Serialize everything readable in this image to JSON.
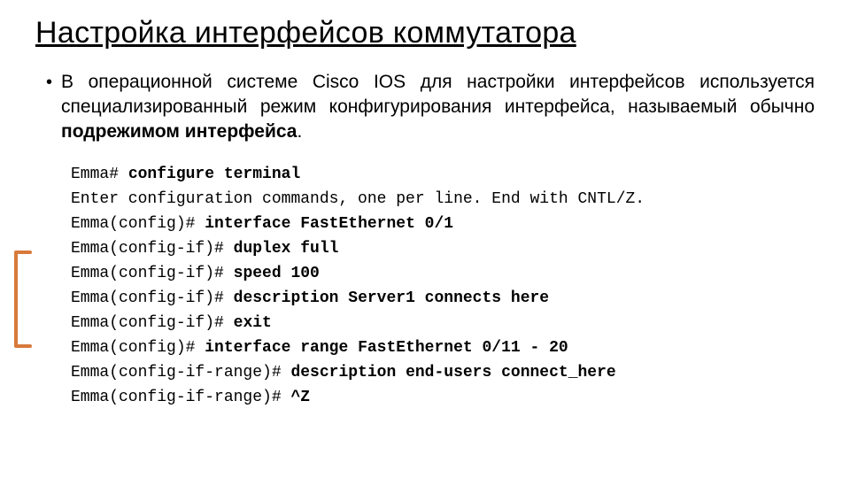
{
  "title": "Настройка интерфейсов коммутатора",
  "paragraph": {
    "lead": "В операционной системе Cisco IOS для настройки интерфейсов используется специализированный режим конфигурирования интерфейса, называемый обычно ",
    "bold": "подрежимом интерфейса",
    "tail": "."
  },
  "terminal": [
    {
      "prompt": "Emma# ",
      "cmd": "configure terminal"
    },
    {
      "plain": "Enter configuration commands, one per line. End with CNTL/Z."
    },
    {
      "prompt": "Emma(config)# ",
      "cmd": "interface FastEthernet 0/1"
    },
    {
      "prompt": "Emma(config-if)# ",
      "cmd": "duplex full"
    },
    {
      "prompt": "Emma(config-if)# ",
      "cmd": "speed 100"
    },
    {
      "prompt": "Emma(config-if)# ",
      "cmd": "description Server1 connects here"
    },
    {
      "prompt": "Emma(config-if)# ",
      "cmd": "exit"
    },
    {
      "prompt": "Emma(config)# ",
      "cmd": "interface range FastEthernet 0/11 - 20"
    },
    {
      "prompt": "Emma(config-if-range)# ",
      "cmd": "description end-users connect_here"
    },
    {
      "prompt": "Emma(config-if-range)# ",
      "cmd": "^Z"
    }
  ]
}
